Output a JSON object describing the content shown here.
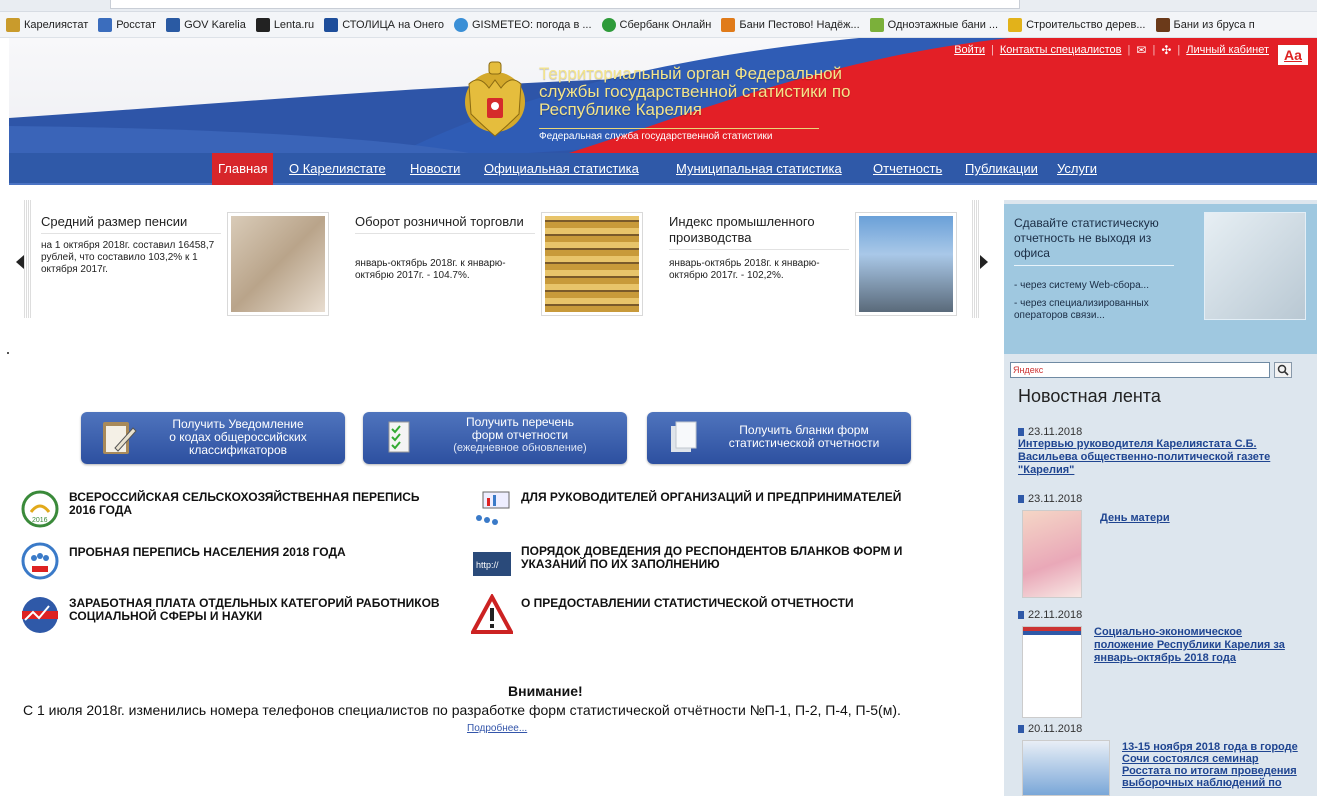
{
  "bookmarks": [
    {
      "label": "Карелиястат",
      "color": "#c99b2c"
    },
    {
      "label": "Росстат",
      "color": "#3b6dbd"
    },
    {
      "label": "GOV Karelia",
      "color": "#2a5aa3"
    },
    {
      "label": "Lenta.ru",
      "color": "#222222"
    },
    {
      "label": "СТОЛИЦА на Онего",
      "color": "#1e4e9b"
    },
    {
      "label": "GISMETEO: погода в ...",
      "color": "#3a8fd6"
    },
    {
      "label": "Сбербанк Онлайн",
      "color": "#2e9b3a"
    },
    {
      "label": "Бани Пестово! Надёж...",
      "color": "#e07b1a"
    },
    {
      "label": "Одноэтажные бани ...",
      "color": "#7bb03a"
    },
    {
      "label": "Строительство дерев...",
      "color": "#e2b21a"
    },
    {
      "label": "Бани из бруса п",
      "color": "#6b3a1a"
    }
  ],
  "header": {
    "title": "Территориальный орган Федеральной службы государственной статистики по Республике Карелия",
    "subtitle": "Федеральная служба государственной статистики",
    "links": {
      "login": "Войти",
      "contacts": "Контакты специалистов",
      "cabinet": "Личный кабинет"
    },
    "font_toggle": "Aa"
  },
  "nav": {
    "items": [
      "Главная",
      "О Карелиястате",
      "Новости",
      "Официальная статистика",
      "Муниципальная статистика",
      "Отчетность",
      "Публикации",
      "Услуги"
    ]
  },
  "slides": [
    {
      "title": "Средний размер пенсии",
      "desc": "на 1 октября 2018г. составил 16458,7 рублей, что составило 103,2% к 1 октября 2017г."
    },
    {
      "title": "Оборот розничной торговли",
      "desc": "январь-октябрь 2018г. к январю-октябрю 2017г. - 104.7%."
    },
    {
      "title": "Индекс промышленного производства",
      "desc": "январь-октябрь 2018г. к январю-октябрю 2017г. - 102,2%."
    }
  ],
  "buttons": [
    {
      "line1": "Получить Уведомление",
      "line2": "о кодах общероссийских",
      "line3": "классификаторов"
    },
    {
      "line1": "Получить перечень",
      "line2": "форм отчетности",
      "line3": "(ежедневное обновление)"
    },
    {
      "line1": "Получить бланки форм",
      "line2": "статистической отчетности"
    }
  ],
  "topics": [
    {
      "label": "ВСЕРОССИЙСКАЯ СЕЛЬСКОХОЗЯЙСТВЕННАЯ ПЕРЕПИСЬ 2016 ГОДА"
    },
    {
      "label": "ПРОБНАЯ ПЕРЕПИСЬ НАСЕЛЕНИЯ 2018 ГОДА"
    },
    {
      "label": "ЗАРАБОТНАЯ ПЛАТА ОТДЕЛЬНЫХ КАТЕГОРИЙ РАБОТНИКОВ СОЦИАЛЬНОЙ СФЕРЫ И НАУКИ"
    },
    {
      "label": "ДЛЯ РУКОВОДИТЕЛЕЙ ОРГАНИЗАЦИЙ И ПРЕДПРИНИМАТЕЛЕЙ"
    },
    {
      "label": "ПОРЯДОК ДОВЕДЕНИЯ ДО РЕСПОНДЕНТОВ БЛАНКОВ ФОРМ И УКАЗАНИЙ ПО ИХ ЗАПОЛНЕНИЮ"
    },
    {
      "label": "О ПРЕДОСТАВЛЕНИИ СТАТИСТИЧЕСКОЙ ОТЧЕТНОСТИ"
    }
  ],
  "notice": {
    "heading": "Внимание!",
    "text": "С 1 июля 2018г. изменились номера телефонов специалистов по разработке форм статистической отчётности №П-1, П-2, П-4, П-5(м).",
    "more": "Подробнее..."
  },
  "sidebar": {
    "promo_title": "Сдавайте статистическую отчетность не выходя из офиса",
    "promo_link1": "- через систему Web-сбора...",
    "promo_link2": "- через специализированных операторов связи...",
    "search_placeholder": "Яндекс",
    "news_heading": "Новостная лента",
    "news": [
      {
        "date": "23.11.2018",
        "title": "Интервью руководителя Карелиястата С.Б. Васильева общественно-политической газете \"Карелия\""
      },
      {
        "date": "23.11.2018",
        "title": "День матери"
      },
      {
        "date": "22.11.2018",
        "title": "Социально-экономическое положение Республики Карелия за январь-октябрь 2018 года"
      },
      {
        "date": "20.11.2018",
        "title": "13-15 ноября 2018 года в городе Сочи состоялся семинар Росстата по итогам проведения выборочных наблюдений по"
      }
    ]
  },
  "colors": {
    "nav_bg": "#2f59a8",
    "nav_active": "#d7262a",
    "button_bg": "#3a5fae",
    "sidebar_bg": "#dde6ee",
    "promo_bg": "#9fc8e0",
    "link": "#1f4591"
  }
}
